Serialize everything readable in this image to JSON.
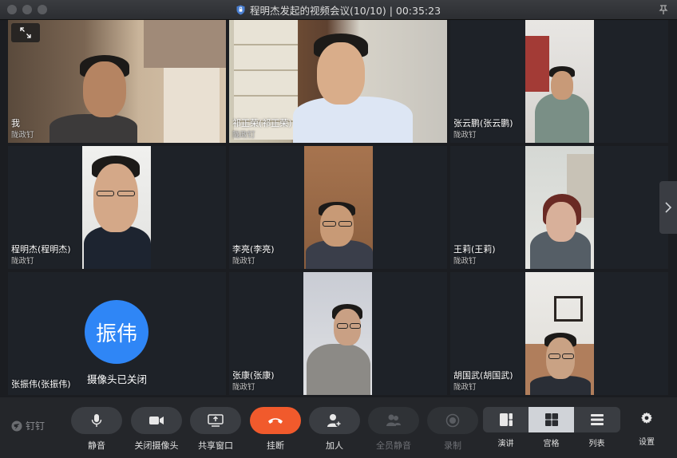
{
  "window": {
    "title": "程明杰发起的视频会议(10/10) | 00:35:23"
  },
  "participants": [
    {
      "name": "我",
      "org": "陇政钉"
    },
    {
      "name": "祁正荣(祁正荣)",
      "org": "陇政钉"
    },
    {
      "name": "张云鹏(张云鹏)",
      "org": "陇政钉"
    },
    {
      "name": "程明杰(程明杰)",
      "org": "陇政钉"
    },
    {
      "name": "李亮(李亮)",
      "org": "陇政钉"
    },
    {
      "name": "王莉(王莉)",
      "org": "陇政钉"
    },
    {
      "name": "张振伟(张振伟)",
      "avatar_text": "振伟",
      "status": "摄像头已关闭"
    },
    {
      "name": "张康(张康)",
      "org": "陇政钉"
    },
    {
      "name": "胡国武(胡国武)",
      "org": "陇政钉"
    }
  ],
  "toolbar": {
    "brand": "钉钉",
    "mute": "静音",
    "camera_off": "关闭摄像头",
    "share": "共享窗口",
    "hangup": "挂断",
    "add": "加人",
    "mute_all": "全员静音",
    "record": "录制",
    "layout_speaker": "演讲",
    "layout_grid": "宫格",
    "layout_list": "列表",
    "settings": "设置"
  },
  "colors": {
    "accent_blue": "#2f86f6",
    "hangup_red": "#f15a2c",
    "background": "#1b1d21"
  }
}
